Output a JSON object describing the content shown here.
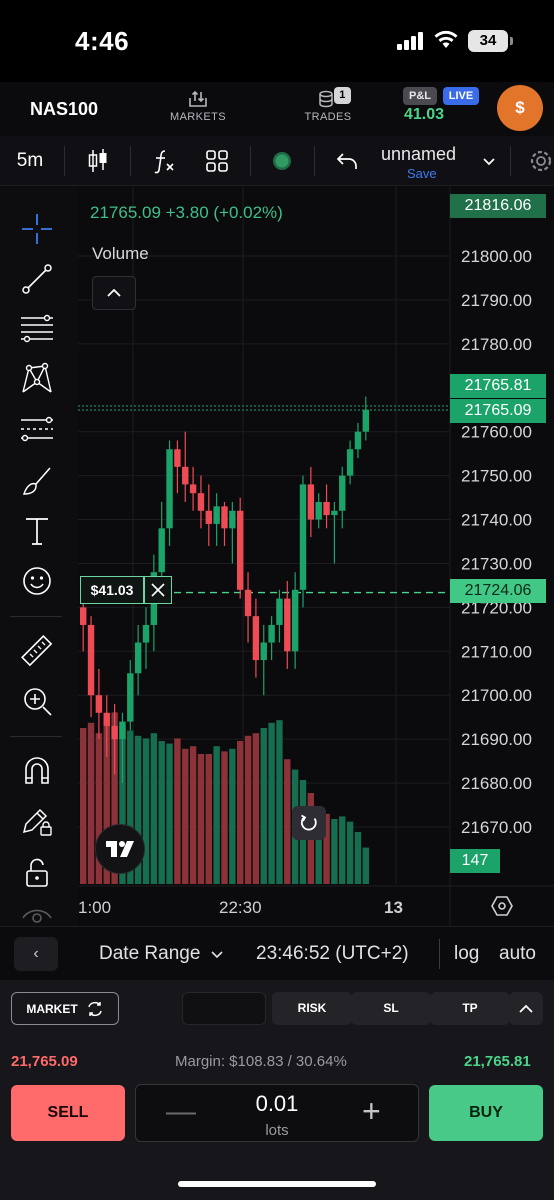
{
  "status_bar": {
    "time": "4:46",
    "battery": "34"
  },
  "header": {
    "symbol": "NAS100",
    "markets_label": "MARKETS",
    "trades_label": "TRADES",
    "trades_count": "1",
    "pl_label": "P&L",
    "live_label": "LIVE",
    "pl_value": "41.03",
    "avatar": "$"
  },
  "toolbar": {
    "timeframe": "5m",
    "layout_name": "unnamed",
    "save_label": "Save",
    "icons": [
      "candles-icon",
      "indicators-icon",
      "templates-icon",
      "replay-dot-icon",
      "undo-icon",
      "chevron-down-icon",
      "settings-icon"
    ]
  },
  "chart": {
    "quote": "21765.09 +3.80 (+0.02%)",
    "volume_label": "Volume",
    "position_pl": "$41.03",
    "price_tags": {
      "top": "21816.06",
      "ask": "21765.81",
      "bid": "21765.09",
      "position": "21724.06",
      "volume": "147"
    },
    "x_labels": [
      "1:00",
      "22:30",
      "13"
    ],
    "colors": {
      "up": "#1ca36a",
      "down": "#ef4b55",
      "vol_up": "#176d4f",
      "vol_down": "#8b3338"
    }
  },
  "chart_data": {
    "type": "candlestick",
    "price_axis": {
      "range": [
        21660,
        21820
      ],
      "ticks": [
        "21800.00",
        "21790.00",
        "21780.00",
        "21760.00",
        "21750.00",
        "21740.00",
        "21730.00",
        "21720.00",
        "21710.00",
        "21700.00",
        "21690.00",
        "21680.00",
        "21670.00"
      ]
    },
    "candles": [
      [
        21720,
        21725,
        21710,
        21716
      ],
      [
        21716,
        21718,
        21695,
        21700
      ],
      [
        21700,
        21706,
        21690,
        21696
      ],
      [
        21696,
        21700,
        21686,
        21693
      ],
      [
        21693,
        21698,
        21682,
        21690
      ],
      [
        21690,
        21696,
        21680,
        21694
      ],
      [
        21694,
        21708,
        21692,
        21705
      ],
      [
        21705,
        21716,
        21700,
        21712
      ],
      [
        21712,
        21720,
        21706,
        21716
      ],
      [
        21716,
        21732,
        21710,
        21728
      ],
      [
        21728,
        21744,
        21724,
        21738
      ],
      [
        21738,
        21758,
        21734,
        21756
      ],
      [
        21756,
        21758,
        21746,
        21752
      ],
      [
        21752,
        21760,
        21744,
        21748
      ],
      [
        21748,
        21752,
        21742,
        21746
      ],
      [
        21746,
        21750,
        21738,
        21742
      ],
      [
        21742,
        21748,
        21734,
        21739
      ],
      [
        21739,
        21746,
        21734,
        21743
      ],
      [
        21743,
        21744,
        21734,
        21738
      ],
      [
        21738,
        21744,
        21730,
        21742
      ],
      [
        21742,
        21745,
        21722,
        21724
      ],
      [
        21724,
        21728,
        21712,
        21718
      ],
      [
        21718,
        21722,
        21704,
        21708
      ],
      [
        21708,
        21716,
        21700,
        21712
      ],
      [
        21712,
        21718,
        21708,
        21716
      ],
      [
        21716,
        21724,
        21712,
        21722
      ],
      [
        21722,
        21726,
        21706,
        21710
      ],
      [
        21710,
        21728,
        21706,
        21724
      ],
      [
        21724,
        21750,
        21720,
        21748
      ],
      [
        21748,
        21752,
        21736,
        21740
      ],
      [
        21740,
        21746,
        21738,
        21744
      ],
      [
        21744,
        21748,
        21738,
        21741
      ],
      [
        21741,
        21744,
        21730,
        21742
      ],
      [
        21742,
        21752,
        21738,
        21750
      ],
      [
        21750,
        21758,
        21748,
        21756
      ],
      [
        21756,
        21762,
        21754,
        21760
      ],
      [
        21760,
        21768,
        21758,
        21765
      ]
    ],
    "volume": [
      60,
      62,
      58,
      64,
      66,
      61,
      59,
      57,
      56,
      58,
      55,
      54,
      56,
      52,
      53,
      50,
      50,
      53,
      51,
      52,
      55,
      57,
      58,
      60,
      62,
      63,
      48,
      44,
      40,
      35,
      30,
      27,
      25,
      26,
      24,
      20,
      14
    ]
  },
  "range_bar": {
    "date_range_label": "Date Range",
    "time": "23:46:52 (UTC+2)",
    "log_label": "log",
    "auto_label": "auto"
  },
  "order_panel": {
    "market_label": "MARKET",
    "risk_label": "RISK",
    "sl_label": "SL",
    "tp_label": "TP",
    "bid": "21,765.09",
    "margin": "Margin: $108.83 / 30.64%",
    "ask": "21,765.81",
    "sell_label": "SELL",
    "buy_label": "BUY",
    "lots_value": "0.01",
    "lots_unit": "lots"
  }
}
